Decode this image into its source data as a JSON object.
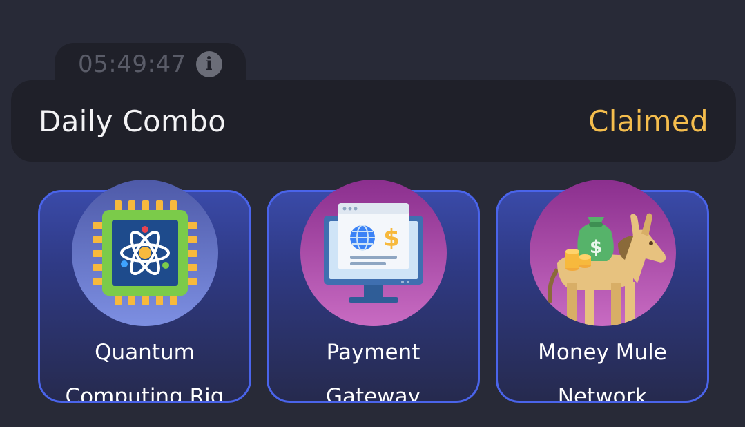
{
  "timer": {
    "value": "05:49:47",
    "icon": "info-icon"
  },
  "combo": {
    "title": "Daily Combo",
    "status": "Claimed",
    "status_color": "#f4bd4d"
  },
  "cards": [
    {
      "line1": "Quantum",
      "line2": "Computing Rig",
      "icon": "quantum-chip-icon"
    },
    {
      "line1": "Payment",
      "line2": "Gateway",
      "icon": "payment-monitor-icon"
    },
    {
      "line1": "Money Mule",
      "line2": "Network",
      "icon": "donkey-money-bag-icon"
    }
  ],
  "colors": {
    "background": "#282a37",
    "panel": "#1f2029",
    "card_border": "#4a64ea"
  }
}
